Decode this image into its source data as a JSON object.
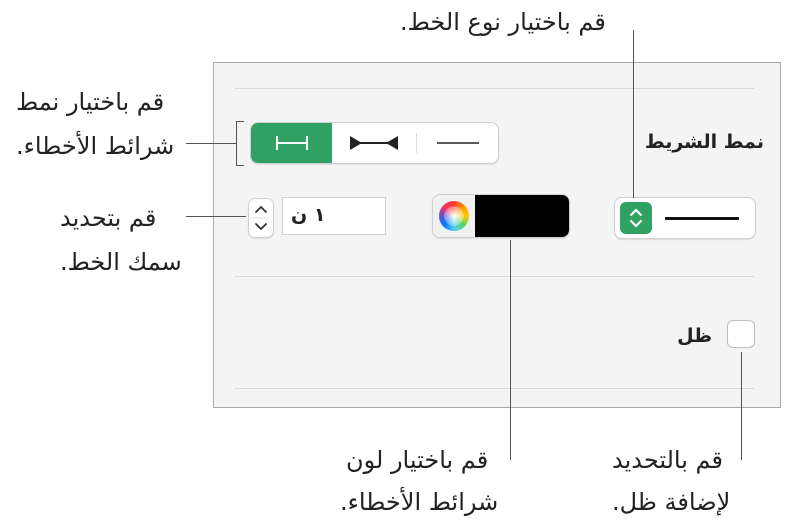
{
  "callouts": {
    "line_type": "قم باختيار نوع الخط.",
    "endpoint_style_1": "قم باختيار نمط",
    "endpoint_style_2": "شرائط الأخطاء.",
    "line_width_1": "قم بتحديد",
    "line_width_2": "سمك الخط.",
    "line_color_1": "قم باختيار لون",
    "line_color_2": "شرائط الأخطاء.",
    "shadow_1": "قم بالتحديد",
    "shadow_2": "لإضافة ظل."
  },
  "panel": {
    "stroke_label": "نمط الشريط",
    "width_value": "١ ن",
    "shadow_label": "ظل",
    "shadow_checked": false
  },
  "colors": {
    "accent": "#2fa163",
    "line_color": "#000000"
  }
}
